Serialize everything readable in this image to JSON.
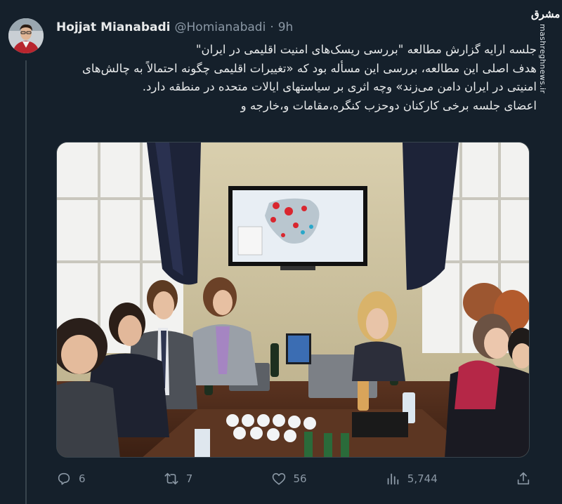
{
  "tweet": {
    "author_name": "Hojjat Mianabadi",
    "handle": "@Homianabadi",
    "separator": "·",
    "time": "9h",
    "lines": [
      "جلسه ارایه گزارش مطالعه \"بررسی ریسک‌های امنیت اقلیمی در ایران\"",
      "هدف اصلی این مطالعه، بررسی این مسأله بود که «تغییرات اقلیمی چگونه احتمالاً به چالش‌های امنیتی در ایران دامن می‌زند» وچه اثری بر سیاستهای ایالات متحده در منطقه دارد.",
      "اعضای جلسه برخی کارکنان دوحزب کنگره،مقامات و،خارجه و"
    ]
  },
  "watermark": {
    "logo_text": "مشرق",
    "site": "mashreghnews.ir"
  },
  "actions": {
    "replies": "6",
    "retweets": "7",
    "likes": "56",
    "views": "5,744"
  },
  "icons": {
    "reply": "reply-icon",
    "retweet": "retweet-icon",
    "like": "heart-icon",
    "views": "views-chart-icon",
    "share": "share-icon"
  },
  "colors": {
    "background": "#15202b",
    "text_primary": "#e7e9ea",
    "text_secondary": "#8b98a5",
    "divider": "#38444d"
  }
}
